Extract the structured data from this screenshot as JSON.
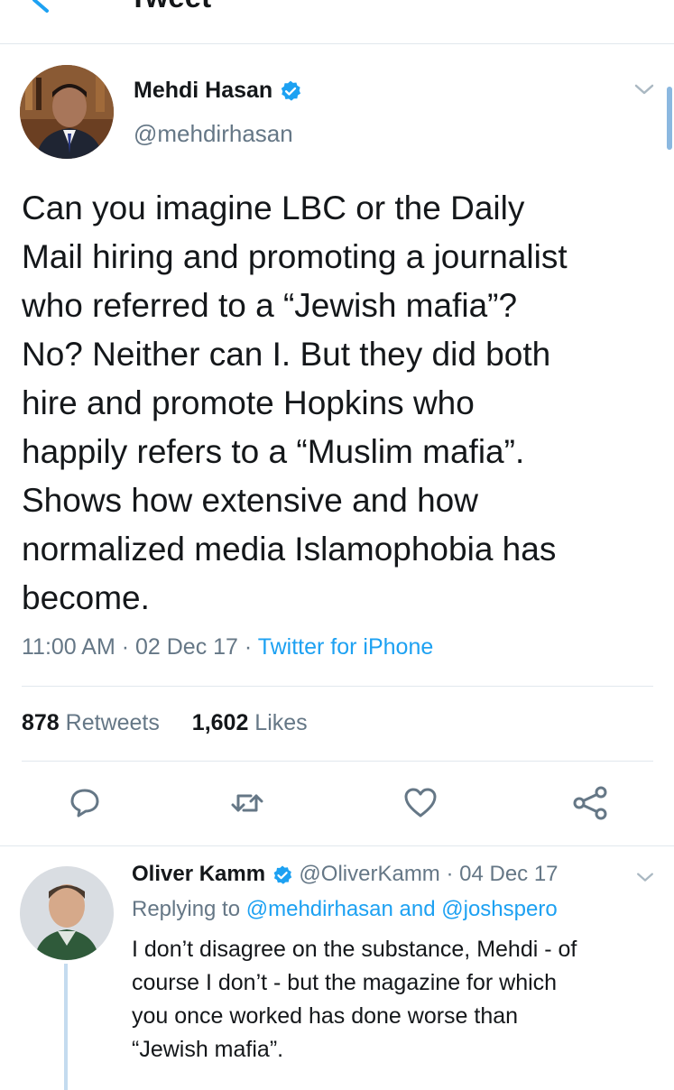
{
  "header": {
    "title": "Tweet"
  },
  "tweet": {
    "author_name": "Mehdi Hasan",
    "author_handle": "@mehdirhasan",
    "text": "Can you imagine LBC or the Daily\nMail hiring and promoting a journalist\nwho referred to a “Jewish mafia”?\nNo? Neither can I. But they did both\nhire and promote Hopkins who\nhappily refers to a “Muslim mafia”.\nShows how extensive and how\nnormalized media Islamophobia has\nbecome.",
    "time": "11:00 AM",
    "sep1": " · ",
    "date": "02 Dec 17",
    "sep2": " · ",
    "source": "Twitter for iPhone",
    "retweets_count": "878",
    "retweets_label": " Retweets",
    "likes_count": "1,602",
    "likes_label": " Likes"
  },
  "actions": {
    "reply_icon": "comment-icon",
    "retweet_icon": "retweet-icon",
    "like_icon": "heart-icon",
    "share_icon": "share-icon"
  },
  "reply": {
    "author_name": "Oliver Kamm",
    "author_handle": "@OliverKamm",
    "sep": " · ",
    "date": "04 Dec 17",
    "replying_prefix": "Replying to ",
    "replying_user1": "@mehdirhasan",
    "replying_and": " and ",
    "replying_user2": "@joshspero",
    "text": "I don’t disagree on the substance, Mehdi - of\ncourse I don’t - but the magazine for which\nyou once worked has done worse than\n“Jewish mafia”."
  },
  "colors": {
    "accent": "#1da1f2",
    "secondary_text": "#657786",
    "divider": "#e1e8ed"
  }
}
